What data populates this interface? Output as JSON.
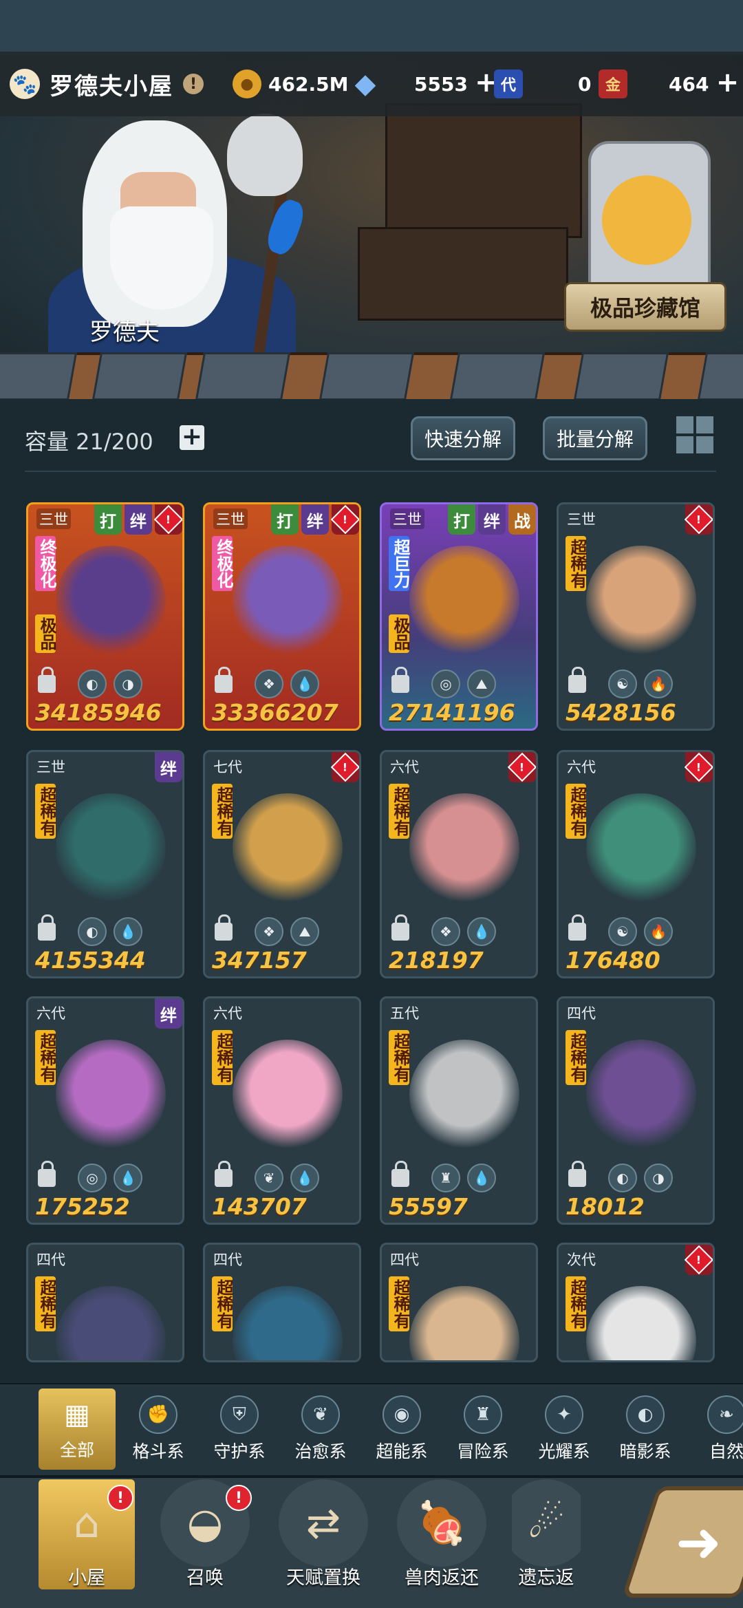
{
  "header": {
    "title": "罗德夫小屋",
    "paw_icon": "paw-icon",
    "info_mark": "!",
    "resources": {
      "gold": {
        "icon": "gold-coin-icon",
        "value": "462.5M"
      },
      "diamond": {
        "icon": "diamond-icon",
        "value": "5553"
      },
      "ticket_dai": {
        "icon": "ticket-icon",
        "glyph": "代",
        "value": "0"
      },
      "ticket_jin": {
        "icon": "ticket-icon",
        "glyph": "金",
        "value": "464"
      }
    }
  },
  "scene": {
    "npc_name": "罗德夫",
    "collection_button": "极品珍藏馆"
  },
  "inventory": {
    "capacity": "容量 21/200",
    "quick_decompose": "快速分解",
    "batch_decompose": "批量分解",
    "cards": [
      {
        "gen": "三世",
        "tags": [
          "打",
          "绊"
        ],
        "warn": true,
        "rarity": "终极化",
        "quality": "极品",
        "style": "gold",
        "elements": [
          "◐",
          "◑"
        ],
        "power": "34185946"
      },
      {
        "gen": "三世",
        "tags": [
          "打",
          "绊"
        ],
        "warn": true,
        "rarity": "终极化",
        "style": "gold",
        "elements": [
          "❖",
          "💧"
        ],
        "power": "33366207"
      },
      {
        "gen": "三世",
        "tags": [
          "打",
          "绊",
          "战"
        ],
        "warn": false,
        "rarity": "超巨力",
        "quality": "极品",
        "style": "purple",
        "elements": [
          "◎",
          "⛰"
        ],
        "power": "27141196"
      },
      {
        "gen": "三世",
        "tags": [],
        "warn": true,
        "rarity": "超稀有",
        "style": "normal",
        "elements": [
          "☯",
          "🔥"
        ],
        "power": "5428156"
      },
      {
        "gen": "三世",
        "tags": [
          "绊"
        ],
        "warn": false,
        "rarity": "超稀有",
        "style": "normal",
        "elements": [
          "◐",
          "💧"
        ],
        "power": "4155344"
      },
      {
        "gen": "七代",
        "tags": [],
        "warn": true,
        "rarity": "超稀有",
        "style": "normal",
        "elements": [
          "❖",
          "⛰"
        ],
        "power": "347157"
      },
      {
        "gen": "六代",
        "tags": [],
        "warn": true,
        "rarity": "超稀有",
        "style": "normal",
        "elements": [
          "❖",
          "💧"
        ],
        "power": "218197"
      },
      {
        "gen": "六代",
        "tags": [],
        "warn": true,
        "rarity": "超稀有",
        "style": "normal",
        "elements": [
          "☯",
          "🔥"
        ],
        "power": "176480"
      },
      {
        "gen": "六代",
        "tags": [
          "绊"
        ],
        "warn": false,
        "rarity": "超稀有",
        "style": "normal",
        "elements": [
          "◎",
          "💧"
        ],
        "power": "175252"
      },
      {
        "gen": "六代",
        "tags": [],
        "warn": false,
        "rarity": "超稀有",
        "style": "normal",
        "elements": [
          "❦",
          "💧"
        ],
        "power": "143707"
      },
      {
        "gen": "五代",
        "tags": [],
        "warn": false,
        "rarity": "超稀有",
        "style": "normal",
        "elements": [
          "♜",
          "💧"
        ],
        "power": "55597"
      },
      {
        "gen": "四代",
        "tags": [],
        "warn": false,
        "rarity": "超稀有",
        "style": "normal",
        "elements": [
          "◐",
          "◑"
        ],
        "power": "18012"
      },
      {
        "gen": "四代",
        "tags": [],
        "warn": false,
        "rarity": "超稀有",
        "style": "normal",
        "elements": [],
        "power": ""
      },
      {
        "gen": "四代",
        "tags": [],
        "warn": false,
        "rarity": "超稀有",
        "style": "normal",
        "elements": [],
        "power": ""
      },
      {
        "gen": "四代",
        "tags": [],
        "warn": false,
        "rarity": "超稀有",
        "style": "normal",
        "elements": [],
        "power": ""
      },
      {
        "gen": "次代",
        "tags": [],
        "warn": true,
        "rarity": "超稀有",
        "style": "normal",
        "elements": [],
        "power": ""
      }
    ]
  },
  "categories": [
    {
      "label": "全部",
      "icon": "all-icon",
      "glyph": "▦",
      "active": true
    },
    {
      "label": "格斗系",
      "icon": "fist-icon",
      "glyph": "✊"
    },
    {
      "label": "守护系",
      "icon": "shield-icon",
      "glyph": "⛨"
    },
    {
      "label": "治愈系",
      "icon": "sprout-icon",
      "glyph": "❦"
    },
    {
      "label": "超能系",
      "icon": "alien-icon",
      "glyph": "◉"
    },
    {
      "label": "冒险系",
      "icon": "adventure-icon",
      "glyph": "♜"
    },
    {
      "label": "光耀系",
      "icon": "light-icon",
      "glyph": "✦"
    },
    {
      "label": "暗影系",
      "icon": "shadow-icon",
      "glyph": "◐"
    },
    {
      "label": "自然",
      "icon": "nature-icon",
      "glyph": "❧"
    }
  ],
  "nav": [
    {
      "label": "小屋",
      "icon": "house-icon",
      "glyph": "⌂",
      "badge": "!",
      "active": true
    },
    {
      "label": "召唤",
      "icon": "egg-icon",
      "glyph": "◒",
      "badge": "!"
    },
    {
      "label": "天赋置换",
      "icon": "swap-icon",
      "glyph": "⇄"
    },
    {
      "label": "兽肉返还",
      "icon": "meat-icon",
      "glyph": "🍖"
    },
    {
      "label": "遗忘返",
      "icon": "spirit-icon",
      "glyph": "☄"
    }
  ],
  "go_button_icon": "arrow-right-icon"
}
